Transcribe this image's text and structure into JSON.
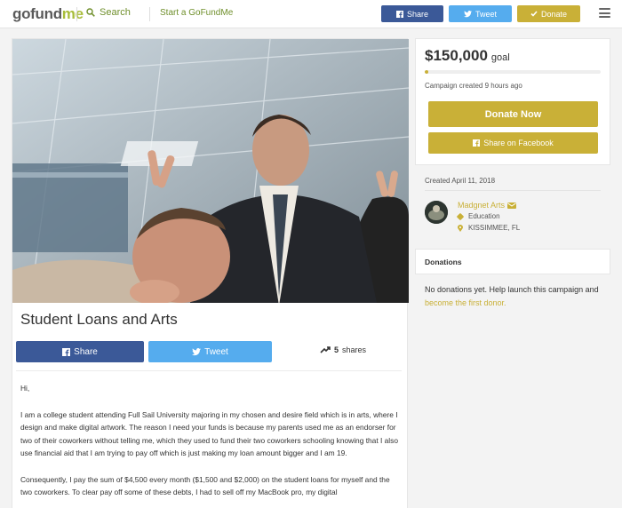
{
  "header": {
    "logo_go": "gofund",
    "logo_me": "me",
    "search_label": "Search",
    "start_label": "Start a GoFundMe",
    "share_label": "Share",
    "tweet_label": "Tweet",
    "donate_label": "Donate"
  },
  "campaign": {
    "title": "Student Loans and Arts",
    "share_label": "Share",
    "tweet_label": "Tweet",
    "shares_count": "5",
    "shares_suffix": "shares",
    "story": [
      "Hi,",
      "I am a college student attending Full Sail University majoring in my chosen and desire field which is in arts, where I design and make digital artwork. The reason I need your funds is because my parents used me as an endorser for two of their coworkers without telling me, which they used to fund their two coworkers schooling knowing that I also use financial aid that I am trying to pay off which is just making my loan amount bigger and I am 19.",
      "Consequently, I pay the sum of $4,500 every month ($1,500 and $2,000) on the student loans for myself and the two coworkers. To clear pay off some of these debts, I had to sell off my MacBook pro, my digital"
    ]
  },
  "sidebar": {
    "goal_amount": "$150,000",
    "goal_label": "goal",
    "progress_fraction": 0.02,
    "created_ago": "Campaign created 9 hours ago",
    "donate_now_label": "Donate Now",
    "share_facebook_label": "Share on Facebook",
    "created_on": "Created April 11, 2018",
    "organizer_name": "Madgnet Arts",
    "category": "Education",
    "location": "KISSIMMEE, FL",
    "donations_title": "Donations",
    "no_donations_text": "No donations yet. Help launch this campaign and ",
    "first_donor_link": "become the first donor."
  },
  "colors": {
    "accent_gold": "#c9b037",
    "facebook": "#3b5998",
    "twitter": "#55acee",
    "brand_green": "#a8bd3a"
  }
}
